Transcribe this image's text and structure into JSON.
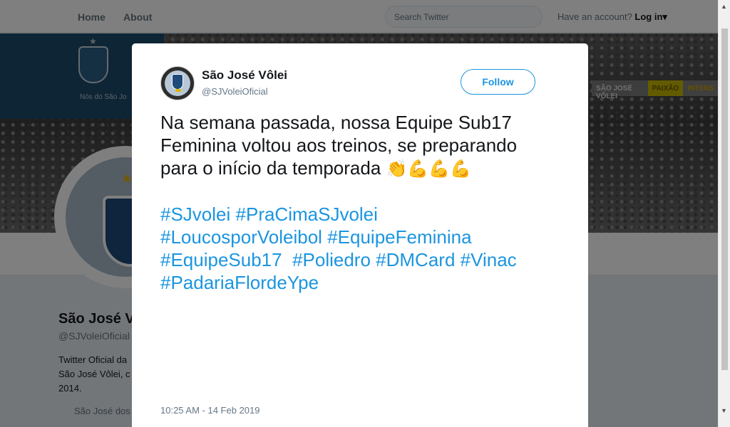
{
  "topbar": {
    "nav": [
      "Home",
      "About"
    ],
    "search_placeholder": "Search Twitter",
    "account_prompt": "Have an account?",
    "login_label": "Log in",
    "login_caret": "▾"
  },
  "banner": {
    "left_caption": "Nós do São Jo",
    "tabs": [
      "SÃO JOSÉ VÔLEI",
      "PAIXÃO",
      "INTENS"
    ]
  },
  "profile": {
    "name": "São José V",
    "handle": "@SJVoleiOficial",
    "bio": "Twitter Oficial da São José Vôlei, c 2014.",
    "location": "São José dos"
  },
  "tweet": {
    "author_name": "São José Vôlei",
    "author_handle": "@SJVoleiOficial",
    "follow_label": "Follow",
    "text_lines": [
      "Na semana passada, nossa Equipe Sub17",
      "Feminina voltou aos treinos, se preparando",
      "para o início da temporada"
    ],
    "emojis": "👏💪💪💪",
    "hashtag_lines": [
      [
        "#SJvolei",
        "#PraCimaSJvolei"
      ],
      [
        "#LoucosporVoleibol",
        "#EquipeFeminina"
      ],
      [
        "#EquipeSub17",
        "#Poliedro",
        "#DMCard",
        "#Vinac"
      ],
      [
        "#PadariaFlordeYpe"
      ]
    ],
    "timestamp": "10:25 AM - 14 Feb 2019"
  },
  "colors": {
    "link": "#1b95e0",
    "text": "#14171a",
    "muted": "#657786"
  },
  "icons": {
    "scroll_up": "▲",
    "scroll_down": "▼"
  }
}
